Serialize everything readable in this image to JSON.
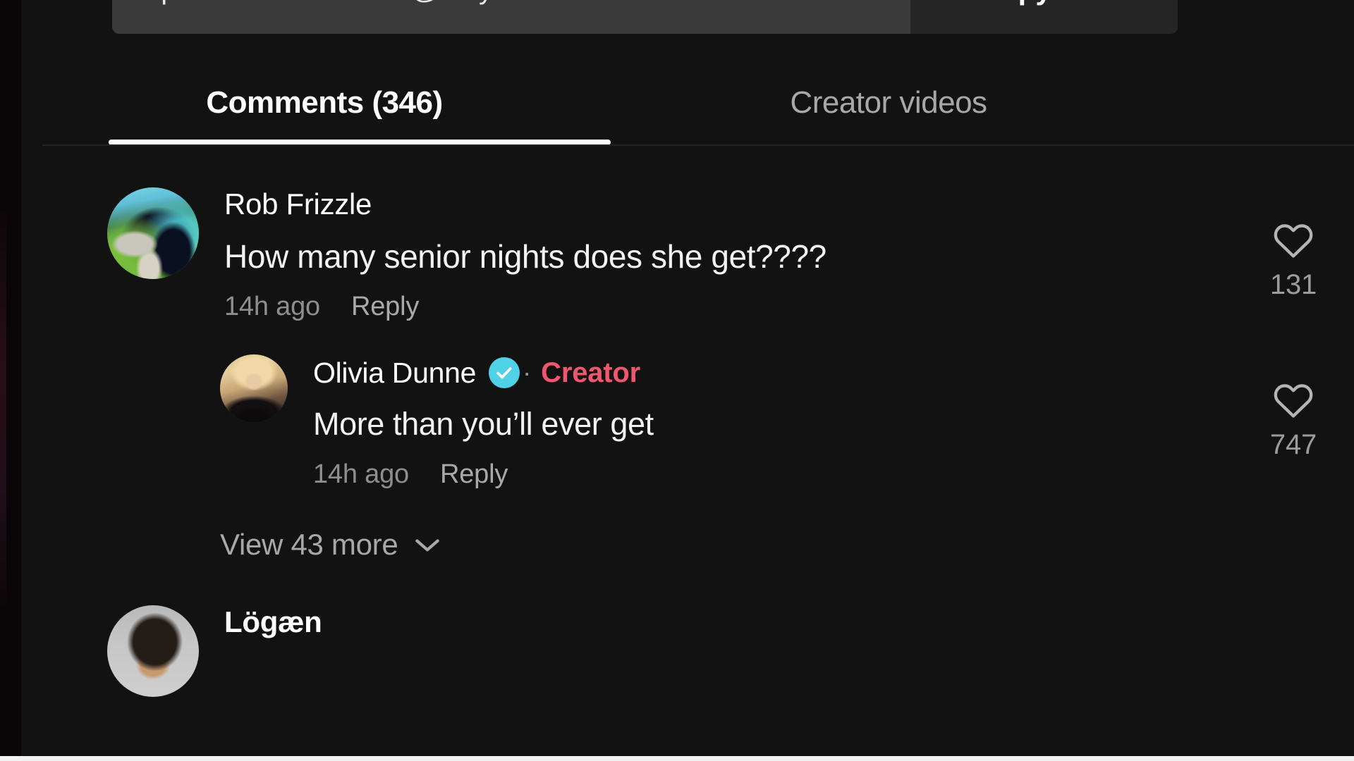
{
  "share": {
    "url": "https://www.tiktok.com/@livvy/video/7479360706572...",
    "copy_label": "Copy link"
  },
  "tabs": [
    {
      "label": "Comments (346)",
      "active": true
    },
    {
      "label": "Creator videos",
      "active": false
    }
  ],
  "colors": {
    "background": "#121212",
    "verified_badge": "#4fd2e8",
    "creator_tag": "#f0566e",
    "text_primary": "#f2f2f2",
    "text_secondary": "#8e8e8e",
    "active_tab_underline": "#ffffff"
  },
  "comments": [
    {
      "author": "Rob Frizzle",
      "avatar": "dog-photo-avatar",
      "text": "How many senior nights does she get????",
      "time": "14h ago",
      "reply_label": "Reply",
      "likes": "131",
      "verified": false,
      "creator": false
    },
    {
      "author": "Olivia Dunne",
      "avatar": "blonde-portrait-avatar",
      "text": "More than you’ll ever get",
      "time": "14h ago",
      "reply_label": "Reply",
      "likes": "747",
      "verified": true,
      "creator_label": "Creator",
      "separator": "·"
    }
  ],
  "view_more": {
    "label": "View 43 more",
    "count": "43"
  },
  "next_comment": {
    "author": "Lögæn",
    "avatar": "dark-hair-portrait-avatar"
  }
}
